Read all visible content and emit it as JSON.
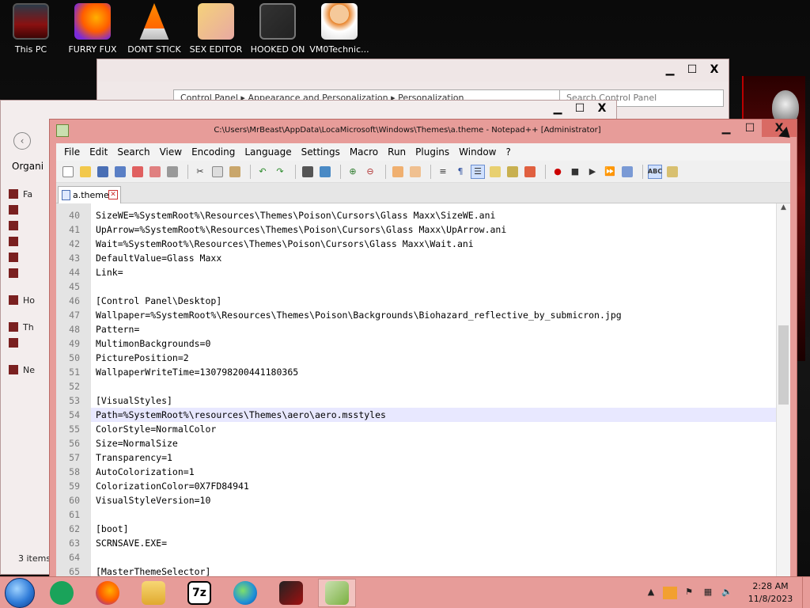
{
  "desktop": {
    "icons": [
      {
        "label": "This PC",
        "icon": "computer-icon"
      },
      {
        "label": "FURRY FUX",
        "icon": "firefox-icon"
      },
      {
        "label": "DONT STICK",
        "icon": "vlc-cone-icon"
      },
      {
        "label": "SEX EDITOR",
        "icon": "anime-character-icon"
      },
      {
        "label": "HOOKED ON",
        "icon": "app-icon"
      },
      {
        "label": "VM0Technic...",
        "icon": "doctor-icon"
      }
    ]
  },
  "control_panel": {
    "address": "Control Panel  ▸  Appearance and Personalization  ▸  Personalization",
    "search_placeholder": "Search Control Panel",
    "minimize": "▁",
    "maximize": "☐",
    "close": "X"
  },
  "explorer": {
    "organize": "Organi",
    "status": "3 items",
    "sidebar": [
      "Fa",
      "",
      "",
      "",
      "",
      "",
      "Ho",
      "Th",
      "",
      "Ne"
    ],
    "minimize": "▁",
    "maximize": "☐",
    "close": "X"
  },
  "notepadpp": {
    "title": "C:\\Users\\MrBeast\\AppData\\LocaMicrosoft\\Windows\\Themes\\a.theme - Notepad++ [Administrator]",
    "minimize": "▁",
    "maximize": "☐",
    "close": "X",
    "menu": [
      "File",
      "Edit",
      "Search",
      "View",
      "Encoding",
      "Language",
      "Settings",
      "Macro",
      "Run",
      "Plugins",
      "Window",
      "?"
    ],
    "tab": {
      "label": "a.theme"
    },
    "lines": [
      {
        "num": "40",
        "text": "SizeWE=%SystemRoot%\\Resources\\Themes\\Poison\\Cursors\\Glass Maxx\\SizeWE.ani"
      },
      {
        "num": "41",
        "text": "UpArrow=%SystemRoot%\\Resources\\Themes\\Poison\\Cursors\\Glass Maxx\\UpArrow.ani"
      },
      {
        "num": "42",
        "text": "Wait=%SystemRoot%\\Resources\\Themes\\Poison\\Cursors\\Glass Maxx\\Wait.ani"
      },
      {
        "num": "43",
        "text": "DefaultValue=Glass Maxx"
      },
      {
        "num": "44",
        "text": "Link="
      },
      {
        "num": "45",
        "text": ""
      },
      {
        "num": "46",
        "text": "[Control Panel\\Desktop]"
      },
      {
        "num": "47",
        "text": "Wallpaper=%SystemRoot%\\Resources\\Themes\\Poison\\Backgrounds\\Biohazard_reflective_by_submicron.jpg"
      },
      {
        "num": "48",
        "text": "Pattern="
      },
      {
        "num": "49",
        "text": "MultimonBackgrounds=0"
      },
      {
        "num": "50",
        "text": "PicturePosition=2"
      },
      {
        "num": "51",
        "text": "WallpaperWriteTime=130798200441180365"
      },
      {
        "num": "52",
        "text": ""
      },
      {
        "num": "53",
        "text": "[VisualStyles]"
      },
      {
        "num": "54",
        "text": "Path=%SystemRoot%\\resources\\Themes\\aero\\aero.msstyles"
      },
      {
        "num": "55",
        "text": "ColorStyle=NormalColor"
      },
      {
        "num": "56",
        "text": "Size=NormalSize"
      },
      {
        "num": "57",
        "text": "Transparency=1"
      },
      {
        "num": "58",
        "text": "AutoColorization=1"
      },
      {
        "num": "59",
        "text": "ColorizationColor=0X7FD84941"
      },
      {
        "num": "60",
        "text": "VisualStyleVersion=10"
      },
      {
        "num": "61",
        "text": ""
      },
      {
        "num": "62",
        "text": "[boot]"
      },
      {
        "num": "63",
        "text": "SCRNSAVE.EXE="
      },
      {
        "num": "64",
        "text": ""
      },
      {
        "num": "65",
        "text": "[MasterThemeSelector]"
      }
    ]
  },
  "taskbar": {
    "apps": [
      "notes-icon",
      "firefox-icon",
      "file-explorer-icon",
      "7zip-icon",
      "edge-icon",
      "game-icon",
      "notepadpp-icon"
    ],
    "sevenzip_label": "7z",
    "time": "2:28 AM",
    "date": "11/8/2023"
  },
  "colors": {
    "accent": "#e79c99",
    "close": "#d96a64"
  }
}
